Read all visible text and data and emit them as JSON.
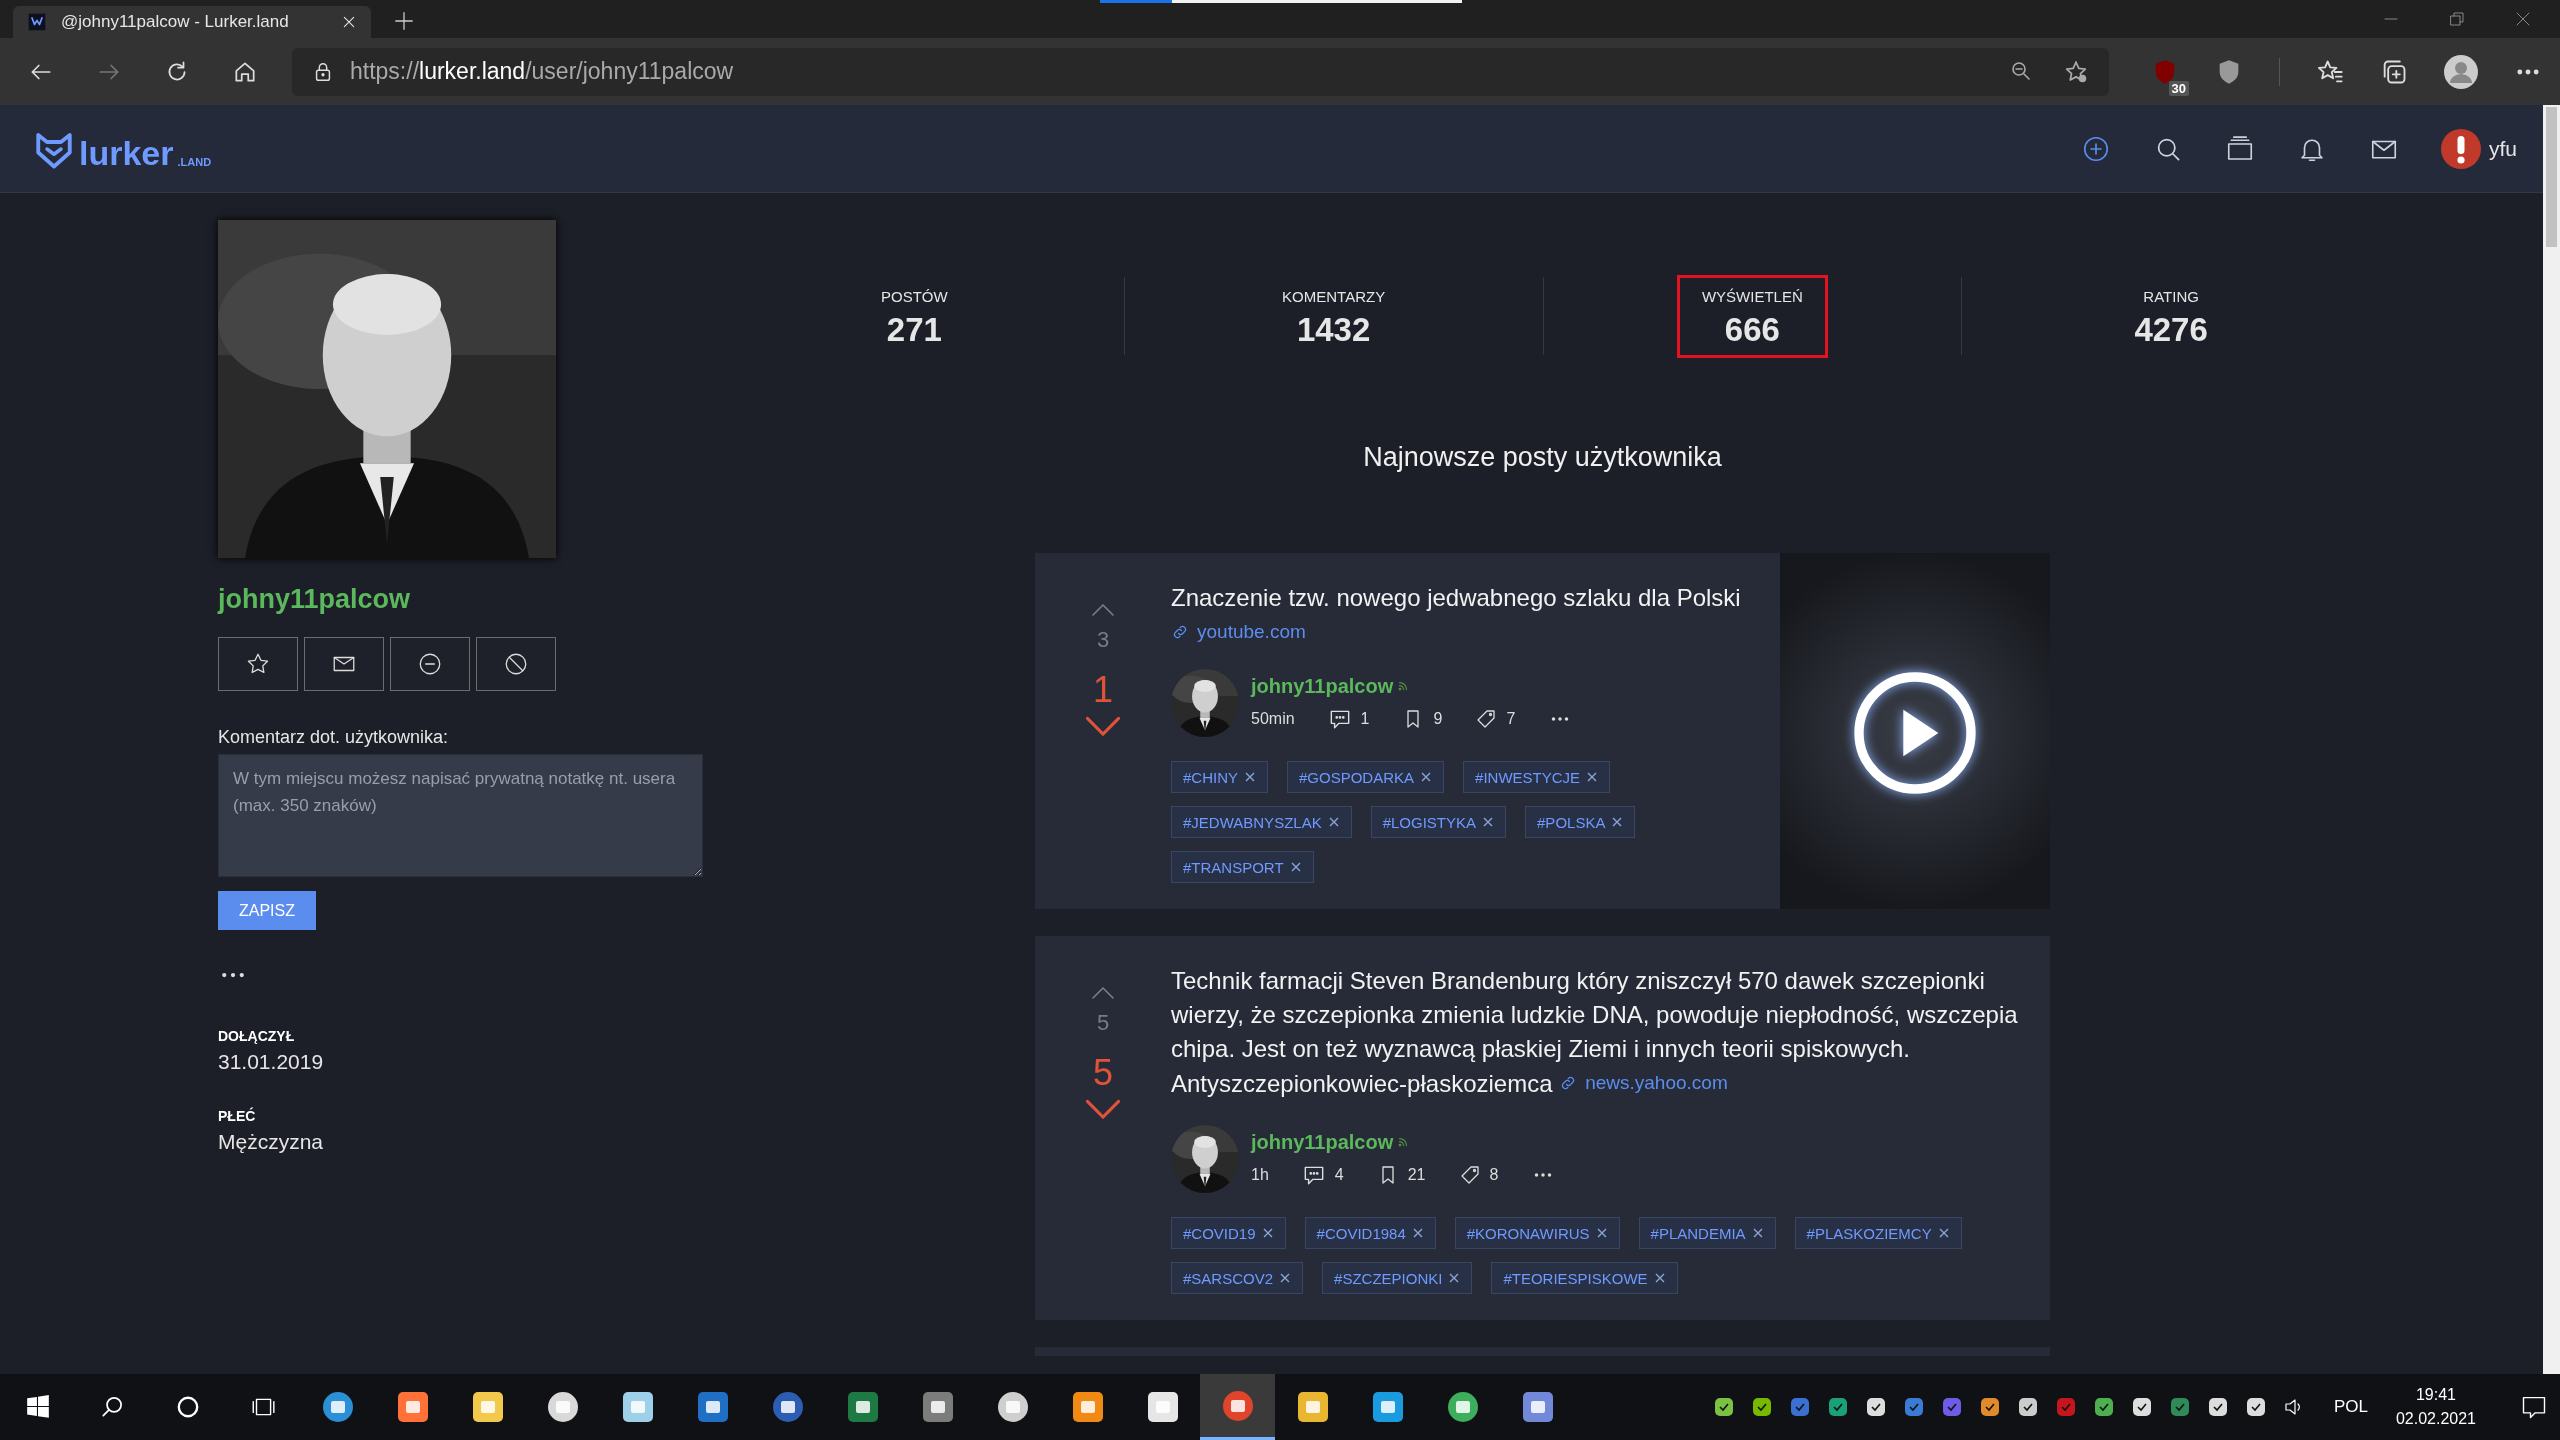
{
  "browser": {
    "loading": {
      "level": 0.2
    },
    "tabs": [
      {
        "title": "@johny11palcow - Lurker.land",
        "selected": true
      }
    ],
    "url": {
      "scheme": "https://",
      "host": "lurker.land",
      "path": "/user/johny11palcow"
    },
    "extension_badge": "30"
  },
  "site": {
    "logo": {
      "name": "lurker",
      "suffix": ".LAND"
    },
    "user": "yfu"
  },
  "profile": {
    "username": "johny11palcow",
    "note": {
      "label": "Komentarz dot. użytkownika:",
      "placeholder": "W tym miejscu możesz napisać prywatną notatkę nt. usera (max. 350 znaków)",
      "button": "ZAPISZ"
    },
    "fields": [
      {
        "label": "DOŁĄCZYŁ",
        "value": "31.01.2019"
      },
      {
        "label": "PŁEĆ",
        "value": "Mężczyzna"
      }
    ]
  },
  "stats": [
    {
      "label": "POSTÓW",
      "value": "271",
      "highlighted": false
    },
    {
      "label": "KOMENTARZY",
      "value": "1432",
      "highlighted": false
    },
    {
      "label": "WYŚWIETLEŃ",
      "value": "666",
      "highlighted": true
    },
    {
      "label": "RATING",
      "value": "4276",
      "highlighted": false
    }
  ],
  "posts_heading": "Najnowsze posty użytkownika",
  "posts": [
    {
      "kind": "video",
      "upvotes": "3",
      "score": "1",
      "downvoted": true,
      "title": "Znaczenie tzw. nowego jedwabnego szlaku dla Polski",
      "link": "youtube.com",
      "author": "johny11palcow",
      "time": "50min",
      "comments": "1",
      "saves": "9",
      "tag_count": "7",
      "tags": [
        "#CHINY",
        "#GOSPODARKA",
        "#INWESTYCJE",
        "#JEDWABNYSZLAK",
        "#LOGISTYKA",
        "#POLSKA",
        "#TRANSPORT"
      ]
    },
    {
      "kind": "article",
      "upvotes": "5",
      "score": "5",
      "downvoted": true,
      "title": "Technik farmacji Steven Brandenburg który zniszczył 570 dawek szczepionki wierzy, że szczepionka zmienia ludzkie DNA, powoduje niepłodność, wszczepia chipa. Jest on też wyznawcą płaskiej Ziemi i innych teorii spiskowych. Antyszczepionkowiec-płaskoziemca",
      "link": "news.yahoo.com",
      "author": "johny11palcow",
      "time": "1h",
      "comments": "4",
      "saves": "21",
      "tag_count": "8",
      "tags": [
        "#COVID19",
        "#COVID1984",
        "#KORONAWIRUS",
        "#PLANDEMIA",
        "#PLASKOZIEMCY",
        "#SARSCOV2",
        "#SZCZEPIONKI",
        "#TEORIESPISKOWE"
      ]
    }
  ],
  "taskbar": {
    "apps": [
      {
        "selected": false
      },
      {
        "selected": false
      },
      {
        "selected": false
      },
      {
        "selected": false
      },
      {
        "selected": false
      },
      {
        "selected": false
      },
      {
        "selected": false
      },
      {
        "selected": false
      },
      {
        "selected": false
      },
      {
        "selected": false
      },
      {
        "selected": false
      },
      {
        "selected": false
      },
      {
        "selected": true
      },
      {
        "selected": false
      },
      {
        "selected": false
      },
      {
        "selected": false
      },
      {
        "selected": false
      }
    ],
    "language": "POL",
    "time": "19:41",
    "date": "02.02.2021"
  }
}
